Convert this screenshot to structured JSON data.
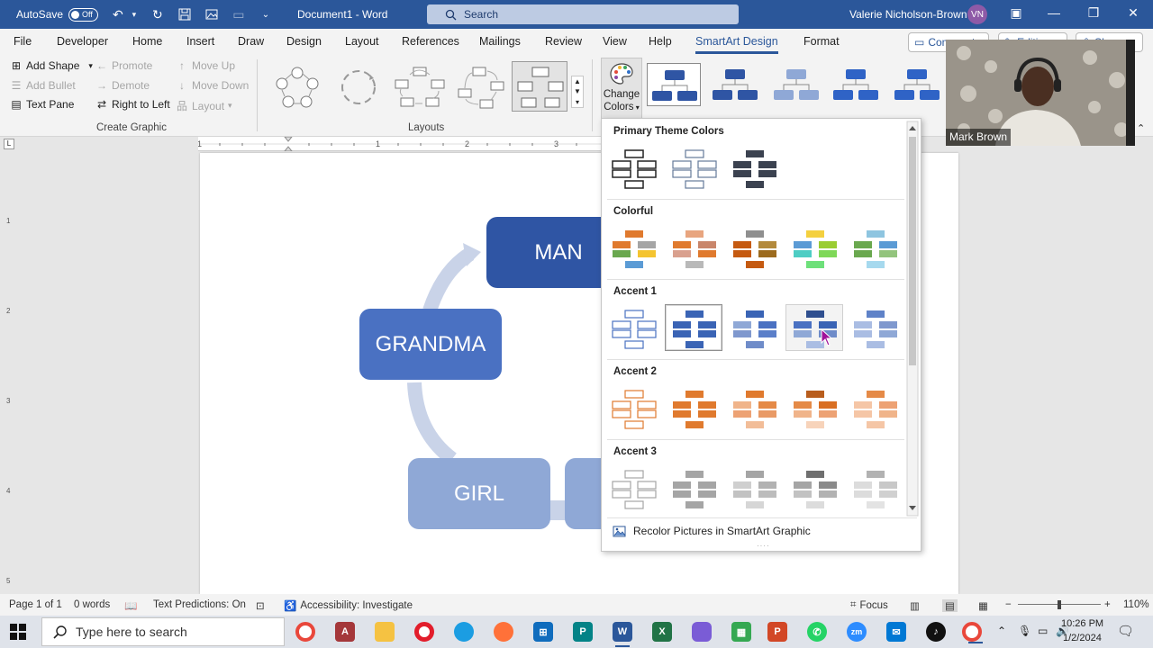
{
  "titlebar": {
    "autosave_label": "AutoSave",
    "autosave_state": "Off",
    "document_title": "Document1  -  Word",
    "search_placeholder": "Search",
    "user_name": "Valerie Nicholson-Brown",
    "user_initials": "VN"
  },
  "tabs": [
    "File",
    "Developer",
    "Home",
    "Insert",
    "Draw",
    "Design",
    "Layout",
    "References",
    "Mailings",
    "Review",
    "View",
    "Help",
    "SmartArt Design",
    "Format"
  ],
  "active_tab": "SmartArt Design",
  "pills": {
    "comments": "Comments",
    "editing": "Editing",
    "share": "Share"
  },
  "ribbon": {
    "create_graphic": {
      "add_shape": "Add Shape",
      "add_bullet": "Add Bullet",
      "text_pane": "Text Pane",
      "promote": "Promote",
      "demote": "Demote",
      "right_to_left": "Right to Left",
      "move_up": "Move Up",
      "move_down": "Move Down",
      "layout": "Layout",
      "group_label": "Create Graphic"
    },
    "layouts_label": "Layouts",
    "change_colors_line1": "Change",
    "change_colors_line2": "Colors"
  },
  "smartart": {
    "nodes": {
      "man": "MAN",
      "grandma": "GRANDMA",
      "girl": "GIRL"
    }
  },
  "colors_dropdown": {
    "sections": {
      "primary": "Primary Theme Colors",
      "colorful": "Colorful",
      "accent1": "Accent 1",
      "accent2": "Accent 2",
      "accent3": "Accent 3"
    },
    "footer": "Recolor Pictures in SmartArt Graphic"
  },
  "webcam": {
    "name": "Mark Brown"
  },
  "statusbar": {
    "page": "Page 1 of 1",
    "words": "0 words",
    "text_predictions": "Text Predictions: On",
    "accessibility": "Accessibility: Investigate",
    "focus": "Focus",
    "zoom": "110%"
  },
  "taskbar": {
    "search_placeholder": "Type here to search",
    "time": "10:26 PM",
    "date": "1/2/2024"
  },
  "colors": {
    "word_blue": "#2b579a",
    "accent1_dark": "#2f55a4",
    "accent1_mid": "#4a71c2",
    "accent1_light": "#8fa8d6",
    "accent2": "#e07a2e",
    "accent3": "#a5a5a5"
  }
}
